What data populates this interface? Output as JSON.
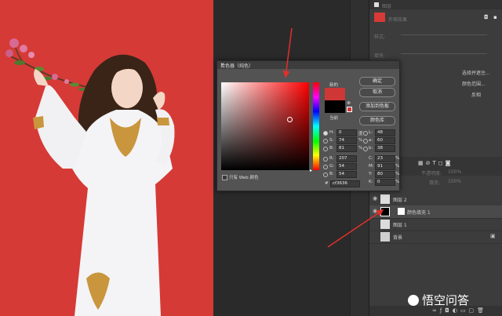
{
  "panel": {
    "top_label": "图层",
    "fill_label": "外观效果",
    "layer_style_label": "样式:",
    "opacity_label": "不透明度:",
    "fill_pct_label": "填充:",
    "side_buttons": [
      "选择并遮住...",
      "颜色范围...",
      "反相"
    ],
    "layers_opacity_label": "不透明度:",
    "layers_opacity_value": "100%",
    "layers_fill_label": "填充:",
    "layers_fill_value": "100%",
    "layers": [
      {
        "name": "图层 2"
      },
      {
        "name": "颜色填充 1"
      },
      {
        "name": "图层 1"
      },
      {
        "name": "背景"
      }
    ],
    "bottom_icons": [
      "link-icon",
      "fx-icon",
      "mask-icon",
      "adjust-icon",
      "folder-icon",
      "new-icon",
      "trash-icon"
    ]
  },
  "dialog": {
    "title": "拾色器（纯色）",
    "close": "×",
    "new_label": "新的",
    "current_label": "当前",
    "new_color": "#cf3636",
    "current_color": "#000000",
    "buttons": {
      "ok": "确定",
      "cancel": "取消",
      "add_swatch": "添加到色板",
      "libraries": "颜色库"
    },
    "web_only_label": "只有 Web 颜色",
    "hex_prefix": "#",
    "hex_value": "cf3636",
    "fields": {
      "H": {
        "label": "H:",
        "value": "0",
        "unit": "度"
      },
      "S": {
        "label": "S:",
        "value": "74",
        "unit": "%"
      },
      "B": {
        "label": "B:",
        "value": "81",
        "unit": "%"
      },
      "R": {
        "label": "R:",
        "value": "207",
        "unit": ""
      },
      "G": {
        "label": "G:",
        "value": "54",
        "unit": ""
      },
      "Bl": {
        "label": "B:",
        "value": "54",
        "unit": ""
      },
      "L": {
        "label": "L:",
        "value": "48",
        "unit": ""
      },
      "a": {
        "label": "a:",
        "value": "60",
        "unit": ""
      },
      "b": {
        "label": "b:",
        "value": "38",
        "unit": ""
      },
      "C": {
        "label": "C:",
        "value": "23",
        "unit": "%"
      },
      "M": {
        "label": "M:",
        "value": "91",
        "unit": "%"
      },
      "Y": {
        "label": "Y:",
        "value": "80",
        "unit": "%"
      },
      "K": {
        "label": "K:",
        "value": "0",
        "unit": "%"
      }
    }
  },
  "watermark": {
    "text": "悟空问答"
  },
  "colors": {
    "canvas_bg": "#d63a36",
    "arrow": "#e0302a"
  }
}
